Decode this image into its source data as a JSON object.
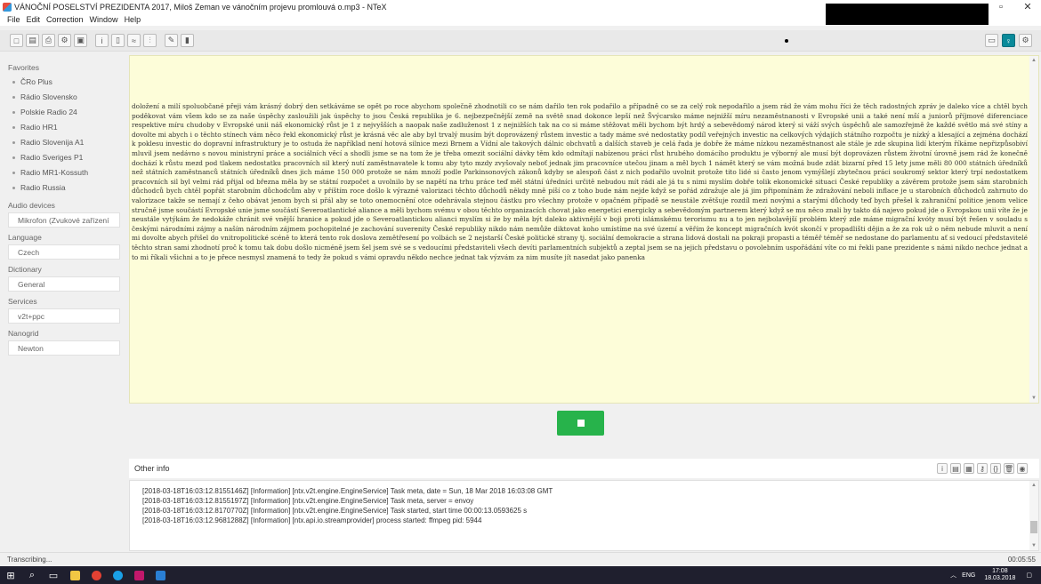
{
  "window": {
    "title": "VÁNOČNÍ POSELSTVÍ PREZIDENTA 2017, Miloš Zeman ve vánočním projevu promlouvá o.mp3 - NTeX",
    "minimize": "–",
    "maximize": "▫",
    "close": "✕"
  },
  "menu": [
    "File",
    "Edit",
    "Correction",
    "Window",
    "Help"
  ],
  "toolbar": {
    "icons": [
      "new-icon",
      "open-icon",
      "print-icon",
      "settings-icon",
      "save-icon",
      "info-icon",
      "document-icon",
      "waveform-icon",
      "chart-icon",
      "pen-icon",
      "bookmark-icon"
    ],
    "right_icons": [
      "window-icon",
      "microphone-icon",
      "gear-icon"
    ]
  },
  "sidebar": {
    "favorites_label": "Favorites",
    "favorites": [
      "ČRo Plus",
      "Rádio Slovensko",
      "Polskie Radio 24",
      "Radio HR1",
      "Radio Slovenija A1",
      "Radio Sveriges P1",
      "Radio MR1-Kossuth",
      "Radio Russia"
    ],
    "audio_label": "Audio devices",
    "audio_value": "Mikrofon (Zvukové zařízení",
    "language_label": "Language",
    "language_value": "Czech",
    "dictionary_label": "Dictionary",
    "dictionary_value": "General",
    "services_label": "Services",
    "services_value": "v2t+ppc",
    "nanogrid_label": "Nanogrid",
    "nanogrid_value": "Newton"
  },
  "transcript": {
    "text": "doložení a milí spoluobčané přeji vám krásný dobrý den setkáváme se opět po roce abychom společně zhodnotili co se nám dařilo ten rok podařilo a případně co se za celý rok nepodařilo a jsem rád že vám mohu říci že těch radostných zpráv je daleko více a chtěl bych poděkovat vám všem kdo se za naše úspěchy zasloužili jak úspěchy to jsou Česká republika je 6. nejbezpečnější země na světě snad dokonce lepší než Švýcarsko máme nejnižší míru nezaměstnanosti v Evropské unii a také není mší a juniorů příjmové diferenciace respektive míru chudoby v Evropské unii náš ekonomický růst je 1 z nejvyšších a naopak naše zadluženost 1 z nejnižších tak na co si máme stěžovat měli bychom být hrdý a sebevědomý národ který si váží svých úspěchů ale samozřejmě že každé světlo má své stíny a dovolte mi abych i o těchto stínech vám něco řekl ekonomický růst je krásná věc ale aby byl trvalý musím být doprovázený růstem investic a tady máme své nedostatky podíl veřejných investic na celkových výdajích státního rozpočtu je nízký a klesající a zejména dochází k poklesu investic do dopravní infrastruktury je to ostuda že například není hotová silnice mezi Brnem a Vídní ale takových dálnic obchvatů a dalších staveb je celá řada je dobře že máme nízkou nezaměstnanost ale stále je zde skupina lidí kterým říkáme nepřizpůsobiví mluvil jsem nedávno s novou ministryní práce a sociálních věcí a shodli jsme se na tom že je třeba omezit sociální dávky těm kdo odmítají nabízenou práci růst hrubého domácího produktu je výborný ale musí být doprovázen růstem životní úrovně jsem rád že konečně dochází k růstu mezd pod tlakem nedostatku pracovních sil který nutí zaměstnavatele k tomu aby tyto mzdy zvyšovaly neboť jednak jim pracovníce utečou jinam a měl bych 1 námět který se vám možná bude zdát bizarní před 15 lety jsme měli 80 000 státních úředníků než státních zaměstnanců státních úředníků dnes jich máme 150 000 protože se nám množí podle Parkinsonových zákonů kdyby se alespoň část z nich podařilo uvolnit protože tito lidé si často jenom vymýšlejí zbytečnou práci soukromý sektor který trpí nedostatkem pracovních sil byl velmi rád přijal od března měla by se státní rozpočet a uvolnilo by se napětí na trhu práce teď měl státní úředníci určitě nebudou mít rádi ale já tu s nimi myslím dobře tolik ekonomické situaci České republiky a závěrem protože jsem sám starobních důchodců bych chtěl popřát starobním důchodcům aby v příštím roce došlo k výrazné valorizaci těchto důchodů někdy mně píší co z toho bude nám nejde když se pořád zdražuje ale já jim připomínám že zdražování neboli inflace je u starobních důchodců zahrnuto do valorizace takže se nemají z čeho obávat jenom bych si přál aby se toto onemocnění otce odehrávala stejnou částku pro všechny protože v opačném případě se neustále zvětšuje rozdíl mezi novými a starými důchody teď bych přešel k zahraniční politice jenom velice stručně jsme součástí Evropské unie jsme součástí Severoatlantické aliance a měli bychom svému v obou těchto organizacích chovat jako energetici energicky a sebevědomým partnerem který když se mu něco znali by takto dá najevo pokud jde o Evropskou unii víte že je neustále vytýkám že nedokáže chránit své vnější hranice a pokud jde o Severoatlantickou alianci myslím si že by měla být daleko aktivnější v boji proti islámskému terorismu nu a to jen nejbolavější problém který zde máme migrační kvóty musí být řešen v souladu s českými národními zájmy a naším národním zájmem pochopitelné je zachování suverenity České republiky nikdo nám nemůže diktovat koho umístíme na své území a věřím že koncept migračních kvót skončí v propadlišti dějin a že za rok už o něm nebude mluvit a není mi dovolte abych přišel do vnitropolitické scéně to která tento rok doslova zemětřesení po volbách se 2 nejstarší České politické strany tj. sociální demokracie a strana lidová dostali na pokraji propasti a téměř téměř se nedostane do parlamentu ať si vedoucí představitelé těchto stran sami zhodnotí proč k tomu tak dobu došlo nicméně jsem šel jsem své se s vedoucími představiteli všech devíti parlamentních subjektů a zeptal jsem se na jejich představu o povolebním uspořádání víte co mi řekli pane prezidente s námi nikdo nechce jednat a to mi říkali všichni a to je přece nesmysl znamená to tedy že pokud s vámi opravdu někdo nechce jednat tak výzvám za nim musíte jít nasedat jako panenka"
  },
  "stop_button_label": "",
  "other_info": {
    "label": "Other info",
    "icons": [
      "info-icon",
      "document-icon",
      "list-icon",
      "key-icon",
      "brackets-icon",
      "trash-icon",
      "camera-icon"
    ],
    "log": [
      "[2018-03-18T16:03:12.8155146Z] [Information] [ntx.v2t.engine.EngineService] Task meta, date = Sun, 18 Mar 2018 16:03:08 GMT",
      "[2018-03-18T16:03:12.8155197Z] [Information] [ntx.v2t.engine.EngineService] Task meta, server = envoy",
      "[2018-03-18T16:03:12.8170770Z] [Information] [ntx.v2t.engine.EngineService] Task started, start time 00:00:13.0593625 s",
      "[2018-03-18T16:03:12.9681288Z] [Information] [ntx.api.io.streamprovider] process started: ffmpeg pid: 5944"
    ]
  },
  "status": {
    "left": "Transcribing...",
    "elapsed": "00:05:55"
  },
  "taskbar": {
    "lang": "ENG",
    "time": "17:08",
    "date": "18.03.2018"
  }
}
